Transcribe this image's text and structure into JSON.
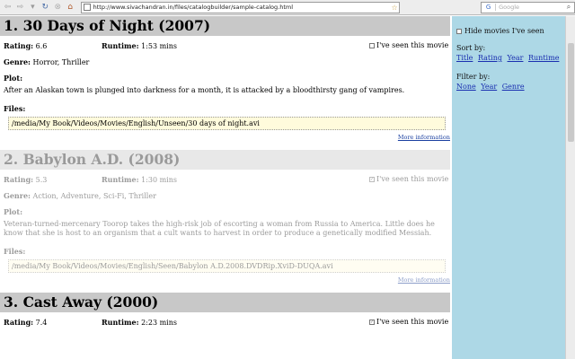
{
  "browser": {
    "url": "http://www.sivachandran.in/files/catalogbuilder/sample-catalog.html",
    "search_engine": "G",
    "search_placeholder": "Google",
    "back": "⇦",
    "forward": "⇨",
    "dropdown": "▾",
    "reload": "↻",
    "stop": "⊗",
    "home": "⌂",
    "star": "☆",
    "search_icon": "⌕"
  },
  "sidebar": {
    "hide_seen_label": "Hide movies I've seen",
    "sort_by_label": "Sort by:",
    "sort_options": [
      "Title",
      "Rating",
      "Year",
      "Runtime"
    ],
    "filter_by_label": "Filter by:",
    "filter_options": [
      "None",
      "Year",
      "Genre"
    ]
  },
  "labels": {
    "rating": "Rating:",
    "runtime": "Runtime:",
    "genre": "Genre:",
    "plot": "Plot:",
    "files": "Files:",
    "seen": "I've seen this movie",
    "more": "More information"
  },
  "movies": [
    {
      "title": "1. 30 Days of Night (2007)",
      "rating": "6.6",
      "runtime": "1:53 mins",
      "genre": "Horror, Thriller",
      "plot": "After an Alaskan town is plunged into darkness for a month, it is attacked by a bloodthirsty gang of vampires.",
      "file": "/media/My Book/Videos/Movies/English/Unseen/30 days of night.avi",
      "seen": false,
      "check_mark": ""
    },
    {
      "title": "2. Babylon A.D. (2008)",
      "rating": "5.3",
      "runtime": "1:30 mins",
      "genre": "Action, Adventure, Sci-Fi, Thriller",
      "plot": "Veteran-turned-mercenary Toorop takes the high-risk job of escorting a woman from Russia to America. Little does he know that she is host to an organism that a cult wants to harvest in order to produce a genetically modified Messiah.",
      "file": "/media/My Book/Videos/Movies/English/Seen/Babylon A.D.2008.DVDRip.XviD-DUQA.avi",
      "seen": true,
      "check_mark": "✓"
    },
    {
      "title": "3. Cast Away (2000)",
      "rating": "7.4",
      "runtime": "2:23 mins",
      "seen": true,
      "check_mark": "✓"
    }
  ]
}
